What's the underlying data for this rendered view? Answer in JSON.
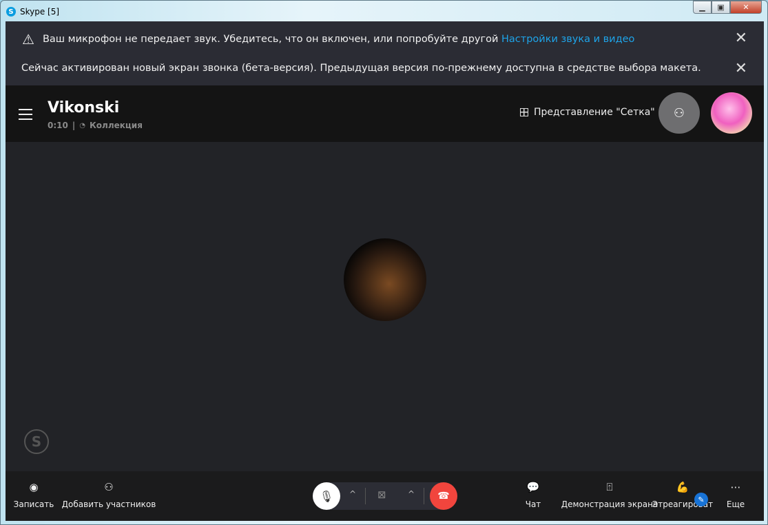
{
  "window": {
    "title": "Skype [5]",
    "controls": [
      "minimize",
      "maximize",
      "close"
    ]
  },
  "banners": [
    {
      "text": "Ваш микрофон не передает звук. Убедитесь, что он включен, или попробуйте другой",
      "link": "Настройки звука и видео",
      "icon": "warning-icon"
    },
    {
      "text": "Сейчас активирован новый экран звонка (бета-версия). Предыдущая версия по-прежнему доступна в средстве выбора макета."
    }
  ],
  "header": {
    "name": "Vikonski",
    "duration": "0:10",
    "separator": "|",
    "collection": "Коллекция",
    "view_label": "Представление \"Сетка\""
  },
  "toolbar": {
    "record": "Записать",
    "add": "Добавить участников",
    "chat": "Чат",
    "share": "Демонстрация экрана",
    "react": "Этреагироват",
    "more": "Еще"
  },
  "colors": {
    "accent": "#1ea4e9",
    "end_call": "#f1453d",
    "banner_bg": "#2b2c34"
  }
}
